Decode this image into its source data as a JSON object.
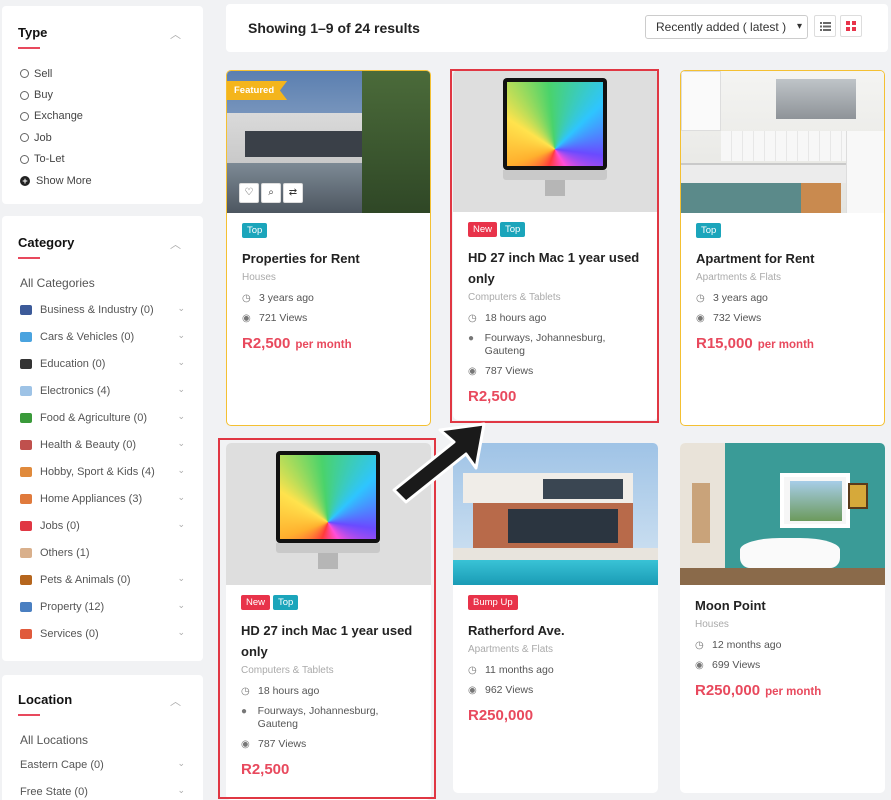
{
  "filters": {
    "type": {
      "title": "Type",
      "options": [
        "Sell",
        "Buy",
        "Exchange",
        "Job",
        "To-Let"
      ],
      "show_more": "Show More"
    },
    "category": {
      "title": "Category",
      "all": "All Categories",
      "items": [
        {
          "label": "Business & Industry (0)",
          "icon": "business-icon",
          "color": "#3c5a99"
        },
        {
          "label": "Cars & Vehicles (0)",
          "icon": "car-icon",
          "color": "#4aa3df"
        },
        {
          "label": "Education (0)",
          "icon": "graduation-cap-icon",
          "color": "#333333"
        },
        {
          "label": "Electronics (4)",
          "icon": "phone-icon",
          "color": "#9ec3e6"
        },
        {
          "label": "Food & Agriculture (0)",
          "icon": "tree-icon",
          "color": "#3a9a3a"
        },
        {
          "label": "Health & Beauty (0)",
          "icon": "beauty-icon",
          "color": "#c0504d"
        },
        {
          "label": "Hobby, Sport & Kids (4)",
          "icon": "kid-icon",
          "color": "#e08a3c"
        },
        {
          "label": "Home Appliances (3)",
          "icon": "appliance-icon",
          "color": "#e07a3c"
        },
        {
          "label": "Jobs (0)",
          "icon": "briefcase-icon",
          "color": "#e03743"
        },
        {
          "label": "Others (1)",
          "icon": "others-icon",
          "color": "#d9b08c"
        },
        {
          "label": "Pets & Animals (0)",
          "icon": "pets-icon",
          "color": "#b5651d"
        },
        {
          "label": "Property (12)",
          "icon": "property-icon",
          "color": "#4a7fc1"
        },
        {
          "label": "Services (0)",
          "icon": "services-icon",
          "color": "#e05a3c"
        }
      ]
    },
    "location": {
      "title": "Location",
      "all": "All Locations",
      "items": [
        "Eastern Cape (0)",
        "Free State (0)"
      ]
    }
  },
  "toolbar": {
    "results": "Showing 1–9 of 24 results",
    "sort_value": "Recently added ( latest )",
    "list_view": "list-view-icon",
    "grid_view": "grid-view-icon",
    "active_color": "#e8334a"
  },
  "cards": [
    {
      "featured": "Featured",
      "badges": [
        "Top"
      ],
      "title": "Properties for Rent",
      "category": "Houses",
      "time": "3 years ago",
      "views": "721 Views",
      "price": "R2,500",
      "per": "per month"
    },
    {
      "badges": [
        "New",
        "Top"
      ],
      "title": "HD 27 inch Mac 1 year used only",
      "category": "Computers & Tablets",
      "time": "18 hours ago",
      "location": "Fourways, Johannesburg, Gauteng",
      "views": "787 Views",
      "price": "R2,500"
    },
    {
      "badges": [
        "Top"
      ],
      "title": "Apartment for Rent",
      "category": "Apartments & Flats",
      "time": "3 years ago",
      "views": "732 Views",
      "price": "R15,000",
      "per": "per month"
    },
    {
      "badges": [
        "New",
        "Top"
      ],
      "title": "HD 27 inch Mac 1 year used only",
      "category": "Computers & Tablets",
      "time": "18 hours ago",
      "location": "Fourways, Johannesburg, Gauteng",
      "views": "787 Views",
      "price": "R2,500"
    },
    {
      "badges": [
        "Bump Up"
      ],
      "title": "Ratherford Ave.",
      "category": "Apartments & Flats",
      "time": "11 months ago",
      "views": "962 Views",
      "price": "R250,000"
    },
    {
      "badges": [],
      "title": "Moon Point",
      "category": "Houses",
      "time": "12 months ago",
      "views": "699 Views",
      "price": "R250,000",
      "per": "per month"
    }
  ],
  "colors": {
    "accent": "#e8495d",
    "top_badge": "#1ba5bb",
    "featured": "#f4b51c",
    "highlight_border": "#e03743"
  }
}
